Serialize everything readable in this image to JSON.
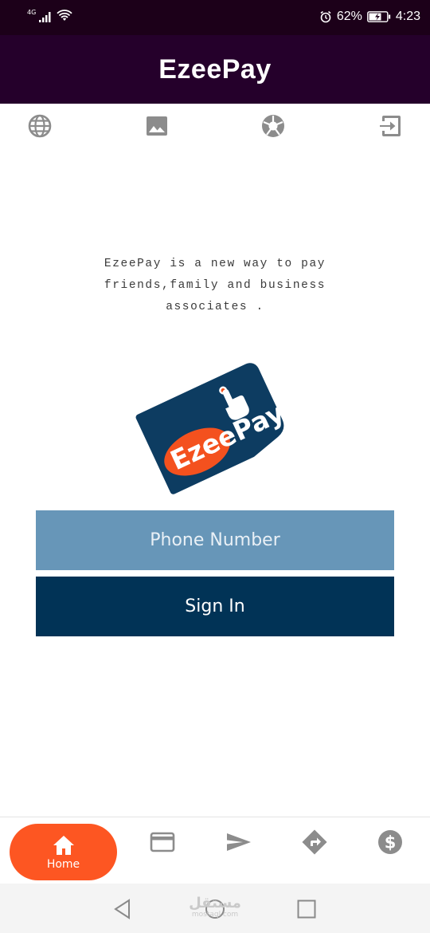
{
  "status_bar": {
    "network": "4G",
    "battery": "62%",
    "time": "4:23"
  },
  "app_bar": {
    "title": "EzeePay"
  },
  "top_icons": [
    "globe-icon",
    "image-icon",
    "camera-shutter-icon",
    "exit-icon"
  ],
  "tagline": "EzeePay is a new way to pay friends,family and business associates .",
  "logo": {
    "text": "EzeePay",
    "colors": {
      "card": "#0d3c61",
      "ellipse": "#f4511e"
    }
  },
  "phone_input": {
    "placeholder": "Phone Number",
    "value": ""
  },
  "sign_in": {
    "label": "Sign In"
  },
  "bottom_nav": {
    "items": [
      {
        "label": "Home",
        "icon": "home-icon",
        "active": true
      },
      {
        "icon": "card-icon"
      },
      {
        "icon": "send-icon"
      },
      {
        "icon": "directions-icon"
      },
      {
        "icon": "dollar-icon"
      }
    ]
  },
  "system_nav": {
    "watermark_ar": "مستقل",
    "watermark_en": "mostaql.com"
  },
  "colors": {
    "status_bar": "#1c0019",
    "app_bar": "#25002b",
    "phone_input": "#6796b8",
    "sign_in": "#013356",
    "accent": "#fd5622",
    "icon_gray": "#8c8c8c"
  }
}
